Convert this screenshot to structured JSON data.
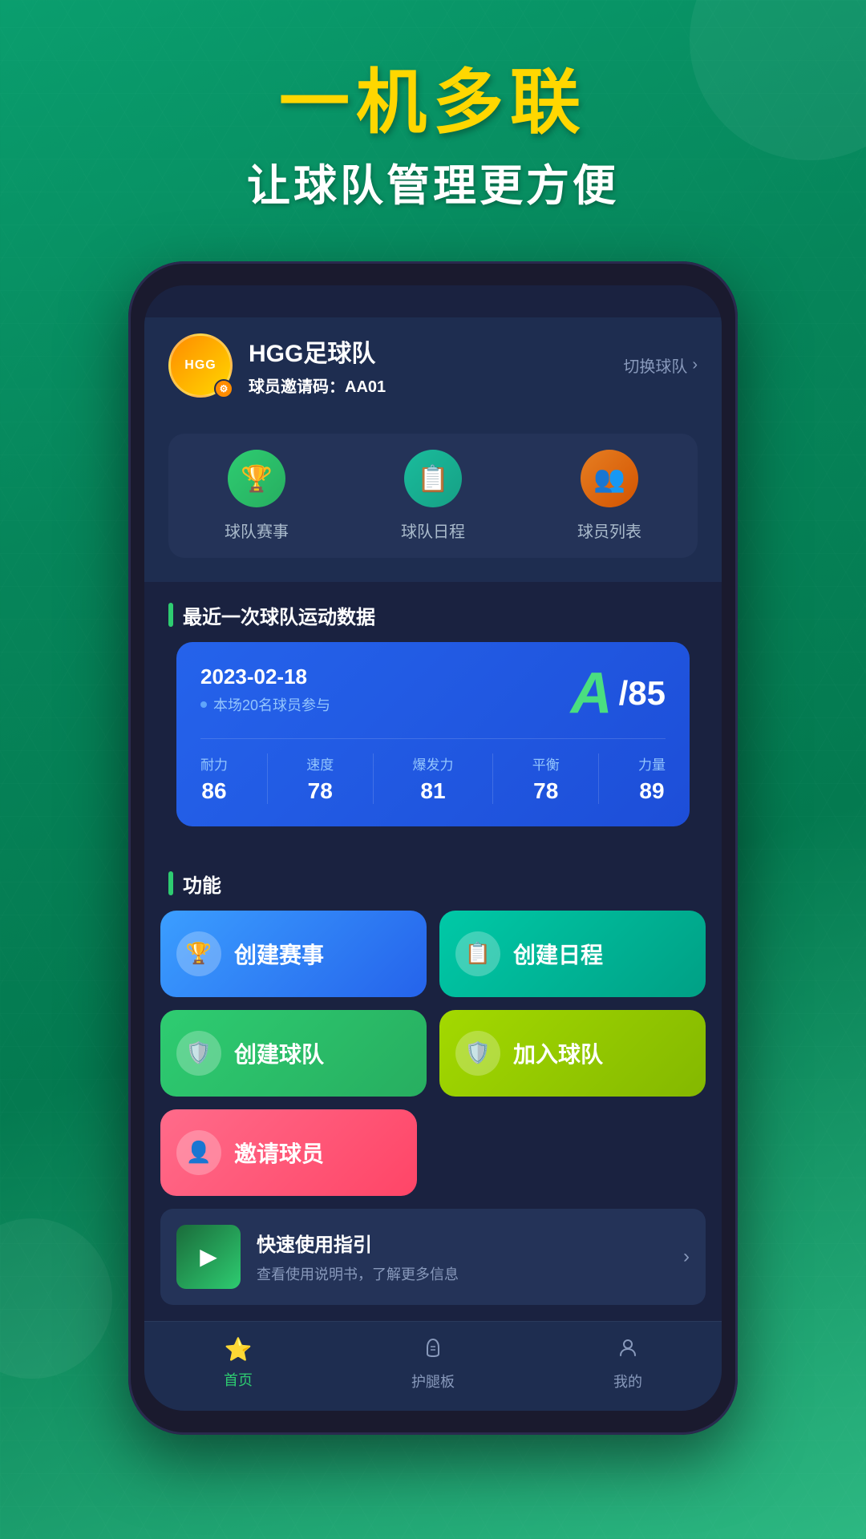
{
  "banner": {
    "title": "一机多联",
    "subtitle": "让球队管理更方便"
  },
  "header": {
    "team_name": "HGG足球队",
    "invite_label": "球员邀请码：",
    "invite_code": "AA01",
    "switch_label": "切换球队"
  },
  "quick_actions": [
    {
      "id": "matches",
      "label": "球队赛事",
      "icon": "🏆",
      "color": "green"
    },
    {
      "id": "schedule",
      "label": "球队日程",
      "icon": "📋",
      "color": "teal"
    },
    {
      "id": "roster",
      "label": "球员列表",
      "icon": "👥",
      "color": "orange"
    }
  ],
  "stats_section": {
    "title": "最近一次球队运动数据",
    "date": "2023-02-18",
    "participants": "本场20名球员参与",
    "grade": "A",
    "score": "/85",
    "metrics": [
      {
        "label": "耐力",
        "value": "86"
      },
      {
        "label": "速度",
        "value": "78"
      },
      {
        "label": "爆发力",
        "value": "81"
      },
      {
        "label": "平衡",
        "value": "78"
      },
      {
        "label": "力量",
        "value": "89"
      }
    ]
  },
  "functions_section": {
    "title": "功能",
    "buttons": [
      {
        "id": "create-match",
        "label": "创建赛事",
        "icon": "🏆",
        "color": "blue"
      },
      {
        "id": "create-schedule",
        "label": "创建日程",
        "icon": "📋",
        "color": "cyan"
      },
      {
        "id": "create-team",
        "label": "创建球队",
        "icon": "🛡️",
        "color": "green"
      },
      {
        "id": "join-team",
        "label": "加入球队",
        "icon": "🛡️",
        "color": "lime"
      },
      {
        "id": "invite-player",
        "label": "邀请球员",
        "icon": "👤",
        "color": "pink"
      }
    ]
  },
  "guide": {
    "title": "快速使用指引",
    "desc": "查看使用说明书，了解更多信息"
  },
  "tab_bar": {
    "tabs": [
      {
        "id": "home",
        "label": "首页",
        "icon": "⭐",
        "active": true
      },
      {
        "id": "shin-guard",
        "label": "护腿板",
        "icon": "🦵",
        "active": false
      },
      {
        "id": "profile",
        "label": "我的",
        "icon": "👤",
        "active": false
      }
    ]
  }
}
